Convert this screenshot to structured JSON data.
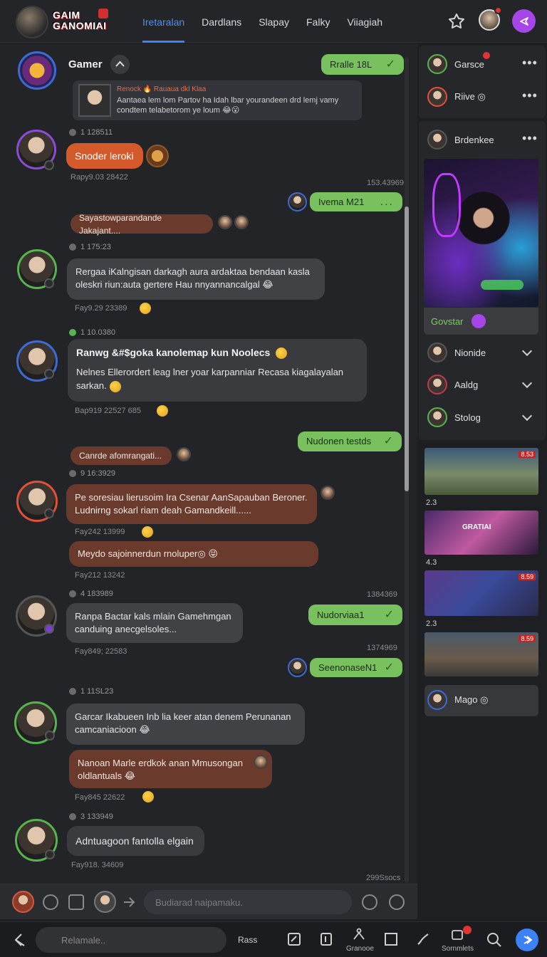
{
  "brand": {
    "title_line1": "GAIM",
    "title_line2": "GANOMIAI"
  },
  "nav": {
    "tabs": [
      "Iretaralan",
      "Dardlans",
      "Slapay",
      "Falky",
      "Viiagiah"
    ]
  },
  "chat": {
    "group": {
      "name": "Gamer",
      "top_bubble": "Rralle 18L"
    },
    "quote": {
      "name": "Renock 🔥 Rauaua dkl Klaa",
      "text": "Aantaea lem lom Partov ha Idah lbar yourandeen drd lemj vamy condtem telabetorom ye loum 😂😮"
    },
    "messages": [
      {
        "id": "m1",
        "meta_top": "1     128511",
        "text": "Snoder leroki",
        "meta_bottom": "Rapy9.03  28422"
      },
      {
        "id": "m2",
        "time": "153.43969",
        "text": "Ivema M21"
      },
      {
        "id": "m3",
        "text": "Sayastowparandande Jakajant...."
      },
      {
        "id": "m4",
        "meta_top": "1     175:23",
        "text": "Rergaa iKalngisan darkagh aura ardaktaa bendaan kasla oleskri riun:auta gertere Hau nnyannancalgal 😂",
        "meta_bottom": "Fay9.29  23389"
      },
      {
        "id": "m5",
        "meta_top": "1     10.0380",
        "title": "Ranwg &#$goka kanolemap kun Noolecs",
        "text": "Nelnes Ellerordert leag lner yoar karpanniar Recasa kiagalayalan sarkan.",
        "meta_bottom": "Bap919  22527   685"
      },
      {
        "id": "m6",
        "text": "Nudonen testds"
      },
      {
        "id": "m7",
        "text": "Canrde afomrangati..."
      },
      {
        "id": "m8",
        "meta_top": "9     16:3929",
        "text": "Pe soresiau lierusoim Ira Csenar AanSapauban Beroner. Ludnirng sokarl riam deah Gamandkeill......",
        "meta_bottom": "Fay242  13999"
      },
      {
        "id": "m9",
        "text": "Meydo sajoinnerdun rnoluper◎ 😝",
        "meta_bottom": "Fay212  13242"
      },
      {
        "id": "m10",
        "time": "1384369",
        "text": "Nudorviaa1"
      },
      {
        "id": "m11",
        "meta_top": "4     183989",
        "text": "Ranpa Bactar kals mlain Gamehmgan canduing anecgelsoles...",
        "meta_bottom": "Fay849;  22583"
      },
      {
        "id": "m12",
        "time": "1374969",
        "text": "SeenonaseN1"
      },
      {
        "id": "m13",
        "meta_top": "1     11SL23",
        "text": "Garcar Ikabueen Inb lia keer atan denem Perunanan camcaniacioon 😂"
      },
      {
        "id": "m14",
        "text": "Nanoan Marle erdkok anan Mmusongan oldlantuals 😂",
        "meta_bottom": "Fay845  22622"
      },
      {
        "id": "m15",
        "meta_top": "3     133949",
        "text": "Adntuagoon fantolla elgain",
        "meta_bottom": "Fay918. 34609"
      },
      {
        "id": "m16",
        "time": "299Ssocs"
      }
    ]
  },
  "composer": {
    "placeholder": "Budiarad naipamaku."
  },
  "bottom": {
    "search_placeholder": "Relamale..",
    "items": [
      "Rass",
      "Granooe",
      "Sornmlets"
    ]
  },
  "right_panel": {
    "users": [
      {
        "name": "Garsce"
      },
      {
        "name": "Riive ◎"
      },
      {
        "name": "Brdenkee"
      }
    ],
    "feature": {
      "label": "Govstar"
    },
    "sections": [
      {
        "name": "Nionide"
      },
      {
        "name": "Aaldg"
      },
      {
        "name": "Stolog"
      }
    ],
    "thumbs": [
      {
        "badge": "8.53",
        "caption": "2.3"
      },
      {
        "badge": "GRATIAI",
        "caption": "4.3"
      },
      {
        "badge": "8.59",
        "caption": "2.3"
      },
      {
        "badge": "8.59",
        "caption": ""
      }
    ],
    "footer_user": {
      "name": "Mago ◎"
    }
  },
  "colors": {
    "accent_blue": "#3b82f6",
    "green_bubble": "#78c15e",
    "brown_bubble": "#6a3a2c",
    "orange_bubble": "#d45a2c",
    "purple": "#a646e8"
  }
}
